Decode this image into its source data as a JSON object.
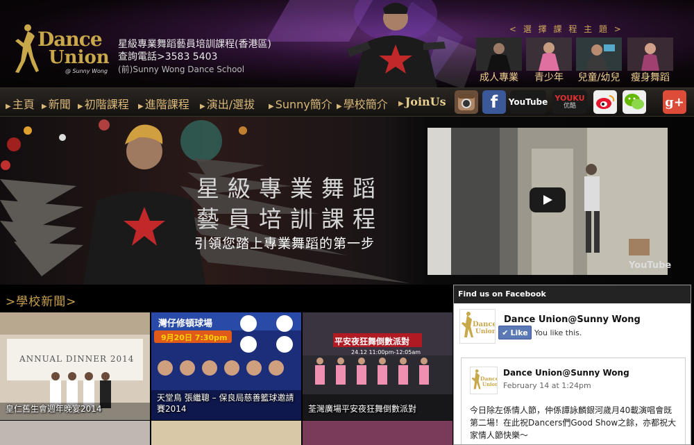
{
  "header": {
    "logo_line1": "Dance",
    "logo_line2": "Union",
    "logo_line3": "@ Sunny Wong",
    "info_title": "星級專業舞蹈藝員培訓課程(香港區)",
    "info_phone": "查詢電話>3583 5403",
    "info_school": "(前)Sunny Wong Dance School"
  },
  "themes": {
    "title": "< 選 擇 課 程 主 題 >",
    "items": [
      {
        "label": "成人專業"
      },
      {
        "label": "青少年"
      },
      {
        "label": "兒童/幼兒"
      },
      {
        "label": "瘦身舞蹈"
      }
    ]
  },
  "nav": {
    "items": [
      {
        "label": "主頁"
      },
      {
        "label": "新聞"
      },
      {
        "label": "初階課程"
      },
      {
        "label": "進階課程"
      },
      {
        "label": "演出/選拔"
      },
      {
        "label": "Sunny簡介"
      },
      {
        "label": "學校簡介"
      },
      {
        "label": "JoinUs"
      }
    ]
  },
  "social": {
    "instagram": "instagram-icon",
    "facebook": "f",
    "youtube": "YouTube",
    "youku": "YOUKU",
    "youku_sub": "优酷",
    "weibo": "weibo-icon",
    "wechat": "wechat-icon",
    "googleplus": "g+"
  },
  "banner": {
    "title_line1": "星級專業舞蹈",
    "title_line2": "藝員培訓課程",
    "subtitle": "引領您踏上專業舞蹈的第一步"
  },
  "video": {
    "watermark": "YouTube"
  },
  "news": {
    "heading": ">學校新聞>",
    "items": [
      {
        "caption": "皇仁舊生會週年晚宴2014",
        "banner": "ANNUAL DINNER 2014"
      },
      {
        "caption": "天堂鳥 張繼聰 – 保良局慈善籃球邀請賽2014",
        "banner": "灣仔修頓球場",
        "date": "9月20日 7:30pm"
      },
      {
        "caption": "荃灣廣場平安夜狂舞倒數派對",
        "banner": "平安夜狂舞倒數派對",
        "date": "24.12 11:00pm-12:05am"
      }
    ]
  },
  "facebook": {
    "bar_title": "Find us on Facebook",
    "page_name": "Dance Union@Sunny Wong",
    "like_label": "Like",
    "like_text": "You like this.",
    "post_author": "Dance Union@Sunny Wong",
    "post_date": "February 14 at 1:24pm",
    "post_text": "今日除左係情人節，仲係譚詠麟銀河歲月40載演唱會既第二場！在此祝Dancers們Good Show之餘，亦都祝大家情人節快樂～"
  },
  "colors": {
    "accent_gold": "#c9a84b",
    "nav_text": "#d9b87a",
    "fb_blue": "#5a79b5"
  }
}
